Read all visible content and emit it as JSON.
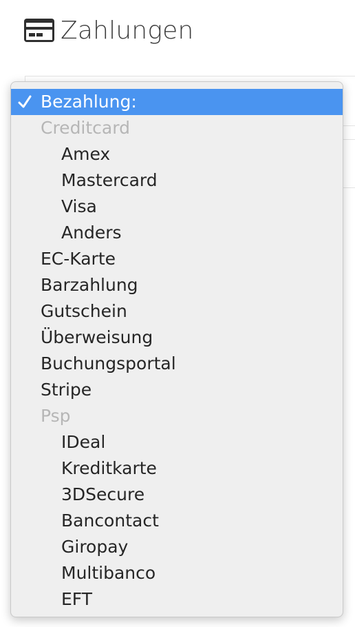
{
  "header": {
    "title": "Zahlungen",
    "icon": "credit-card-icon"
  },
  "dropdown": {
    "selected_label": "Bezahlung:",
    "options": [
      {
        "label": "Bezahlung:",
        "type": "selected"
      },
      {
        "label": "Creditcard",
        "type": "group"
      },
      {
        "label": "Amex",
        "type": "indent"
      },
      {
        "label": "Mastercard",
        "type": "indent"
      },
      {
        "label": "Visa",
        "type": "indent"
      },
      {
        "label": "Anders",
        "type": "indent"
      },
      {
        "label": "EC-Karte",
        "type": "option"
      },
      {
        "label": "Barzahlung",
        "type": "option"
      },
      {
        "label": "Gutschein",
        "type": "option"
      },
      {
        "label": "Überweisung",
        "type": "option"
      },
      {
        "label": "Buchungsportal",
        "type": "option"
      },
      {
        "label": "Stripe",
        "type": "option"
      },
      {
        "label": "Psp",
        "type": "group"
      },
      {
        "label": "IDeal",
        "type": "indent"
      },
      {
        "label": "Kreditkarte",
        "type": "indent"
      },
      {
        "label": "3DSecure",
        "type": "indent"
      },
      {
        "label": "Bancontact",
        "type": "indent"
      },
      {
        "label": "Giropay",
        "type": "indent"
      },
      {
        "label": "Multibanco",
        "type": "indent"
      },
      {
        "label": "EFT",
        "type": "indent"
      }
    ]
  },
  "colors": {
    "selected_bg": "#4a94f0",
    "group_text": "#b6b6b6",
    "menu_bg": "#efefef"
  }
}
